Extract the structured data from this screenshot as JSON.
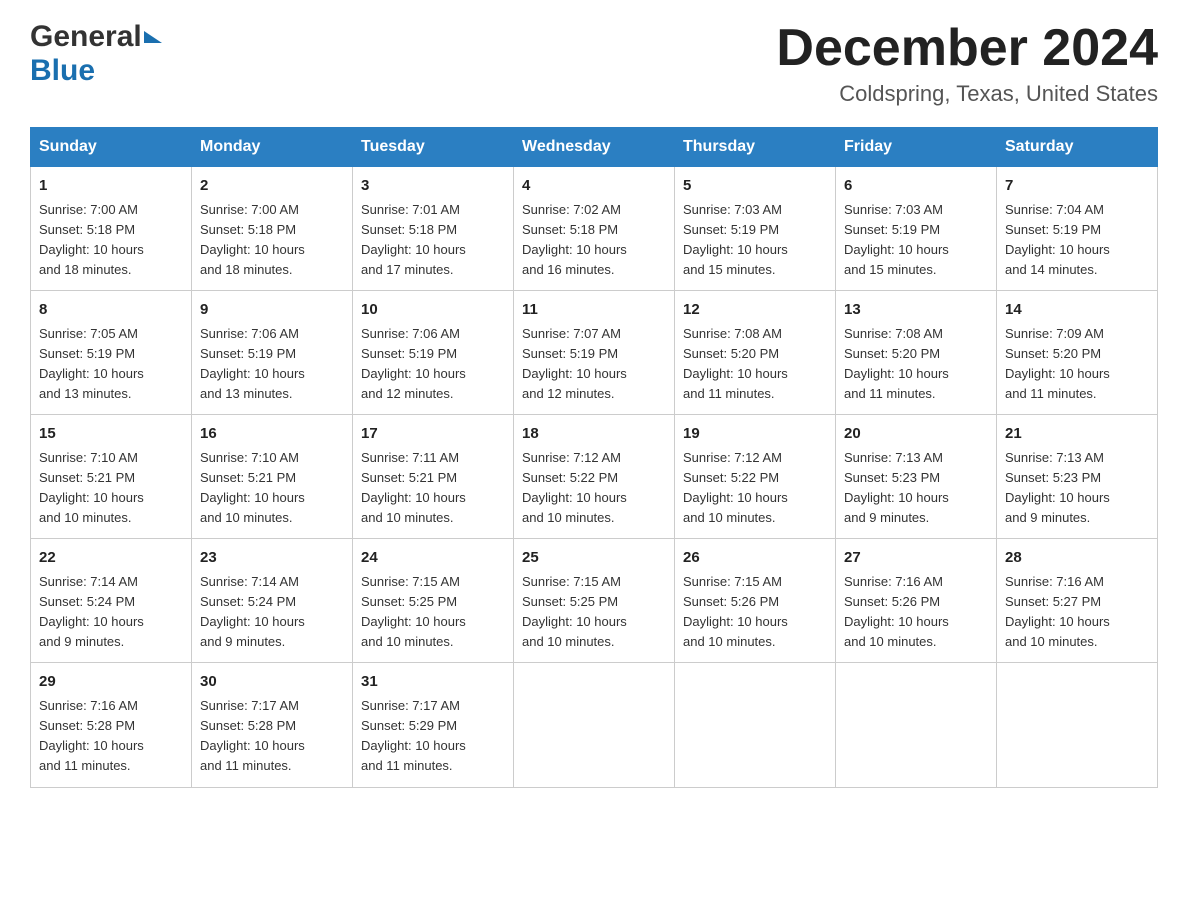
{
  "header": {
    "logo_general": "General",
    "logo_blue": "Blue",
    "month_title": "December 2024",
    "location": "Coldspring, Texas, United States"
  },
  "calendar": {
    "days_of_week": [
      "Sunday",
      "Monday",
      "Tuesday",
      "Wednesday",
      "Thursday",
      "Friday",
      "Saturday"
    ],
    "weeks": [
      [
        {
          "day": "1",
          "sunrise": "7:00 AM",
          "sunset": "5:18 PM",
          "daylight": "10 hours and 18 minutes."
        },
        {
          "day": "2",
          "sunrise": "7:00 AM",
          "sunset": "5:18 PM",
          "daylight": "10 hours and 18 minutes."
        },
        {
          "day": "3",
          "sunrise": "7:01 AM",
          "sunset": "5:18 PM",
          "daylight": "10 hours and 17 minutes."
        },
        {
          "day": "4",
          "sunrise": "7:02 AM",
          "sunset": "5:18 PM",
          "daylight": "10 hours and 16 minutes."
        },
        {
          "day": "5",
          "sunrise": "7:03 AM",
          "sunset": "5:19 PM",
          "daylight": "10 hours and 15 minutes."
        },
        {
          "day": "6",
          "sunrise": "7:03 AM",
          "sunset": "5:19 PM",
          "daylight": "10 hours and 15 minutes."
        },
        {
          "day": "7",
          "sunrise": "7:04 AM",
          "sunset": "5:19 PM",
          "daylight": "10 hours and 14 minutes."
        }
      ],
      [
        {
          "day": "8",
          "sunrise": "7:05 AM",
          "sunset": "5:19 PM",
          "daylight": "10 hours and 13 minutes."
        },
        {
          "day": "9",
          "sunrise": "7:06 AM",
          "sunset": "5:19 PM",
          "daylight": "10 hours and 13 minutes."
        },
        {
          "day": "10",
          "sunrise": "7:06 AM",
          "sunset": "5:19 PM",
          "daylight": "10 hours and 12 minutes."
        },
        {
          "day": "11",
          "sunrise": "7:07 AM",
          "sunset": "5:19 PM",
          "daylight": "10 hours and 12 minutes."
        },
        {
          "day": "12",
          "sunrise": "7:08 AM",
          "sunset": "5:20 PM",
          "daylight": "10 hours and 11 minutes."
        },
        {
          "day": "13",
          "sunrise": "7:08 AM",
          "sunset": "5:20 PM",
          "daylight": "10 hours and 11 minutes."
        },
        {
          "day": "14",
          "sunrise": "7:09 AM",
          "sunset": "5:20 PM",
          "daylight": "10 hours and 11 minutes."
        }
      ],
      [
        {
          "day": "15",
          "sunrise": "7:10 AM",
          "sunset": "5:21 PM",
          "daylight": "10 hours and 10 minutes."
        },
        {
          "day": "16",
          "sunrise": "7:10 AM",
          "sunset": "5:21 PM",
          "daylight": "10 hours and 10 minutes."
        },
        {
          "day": "17",
          "sunrise": "7:11 AM",
          "sunset": "5:21 PM",
          "daylight": "10 hours and 10 minutes."
        },
        {
          "day": "18",
          "sunrise": "7:12 AM",
          "sunset": "5:22 PM",
          "daylight": "10 hours and 10 minutes."
        },
        {
          "day": "19",
          "sunrise": "7:12 AM",
          "sunset": "5:22 PM",
          "daylight": "10 hours and 10 minutes."
        },
        {
          "day": "20",
          "sunrise": "7:13 AM",
          "sunset": "5:23 PM",
          "daylight": "10 hours and 9 minutes."
        },
        {
          "day": "21",
          "sunrise": "7:13 AM",
          "sunset": "5:23 PM",
          "daylight": "10 hours and 9 minutes."
        }
      ],
      [
        {
          "day": "22",
          "sunrise": "7:14 AM",
          "sunset": "5:24 PM",
          "daylight": "10 hours and 9 minutes."
        },
        {
          "day": "23",
          "sunrise": "7:14 AM",
          "sunset": "5:24 PM",
          "daylight": "10 hours and 9 minutes."
        },
        {
          "day": "24",
          "sunrise": "7:15 AM",
          "sunset": "5:25 PM",
          "daylight": "10 hours and 10 minutes."
        },
        {
          "day": "25",
          "sunrise": "7:15 AM",
          "sunset": "5:25 PM",
          "daylight": "10 hours and 10 minutes."
        },
        {
          "day": "26",
          "sunrise": "7:15 AM",
          "sunset": "5:26 PM",
          "daylight": "10 hours and 10 minutes."
        },
        {
          "day": "27",
          "sunrise": "7:16 AM",
          "sunset": "5:26 PM",
          "daylight": "10 hours and 10 minutes."
        },
        {
          "day": "28",
          "sunrise": "7:16 AM",
          "sunset": "5:27 PM",
          "daylight": "10 hours and 10 minutes."
        }
      ],
      [
        {
          "day": "29",
          "sunrise": "7:16 AM",
          "sunset": "5:28 PM",
          "daylight": "10 hours and 11 minutes."
        },
        {
          "day": "30",
          "sunrise": "7:17 AM",
          "sunset": "5:28 PM",
          "daylight": "10 hours and 11 minutes."
        },
        {
          "day": "31",
          "sunrise": "7:17 AM",
          "sunset": "5:29 PM",
          "daylight": "10 hours and 11 minutes."
        },
        null,
        null,
        null,
        null
      ]
    ],
    "sunrise_label": "Sunrise: ",
    "sunset_label": "Sunset: ",
    "daylight_label": "Daylight: "
  }
}
